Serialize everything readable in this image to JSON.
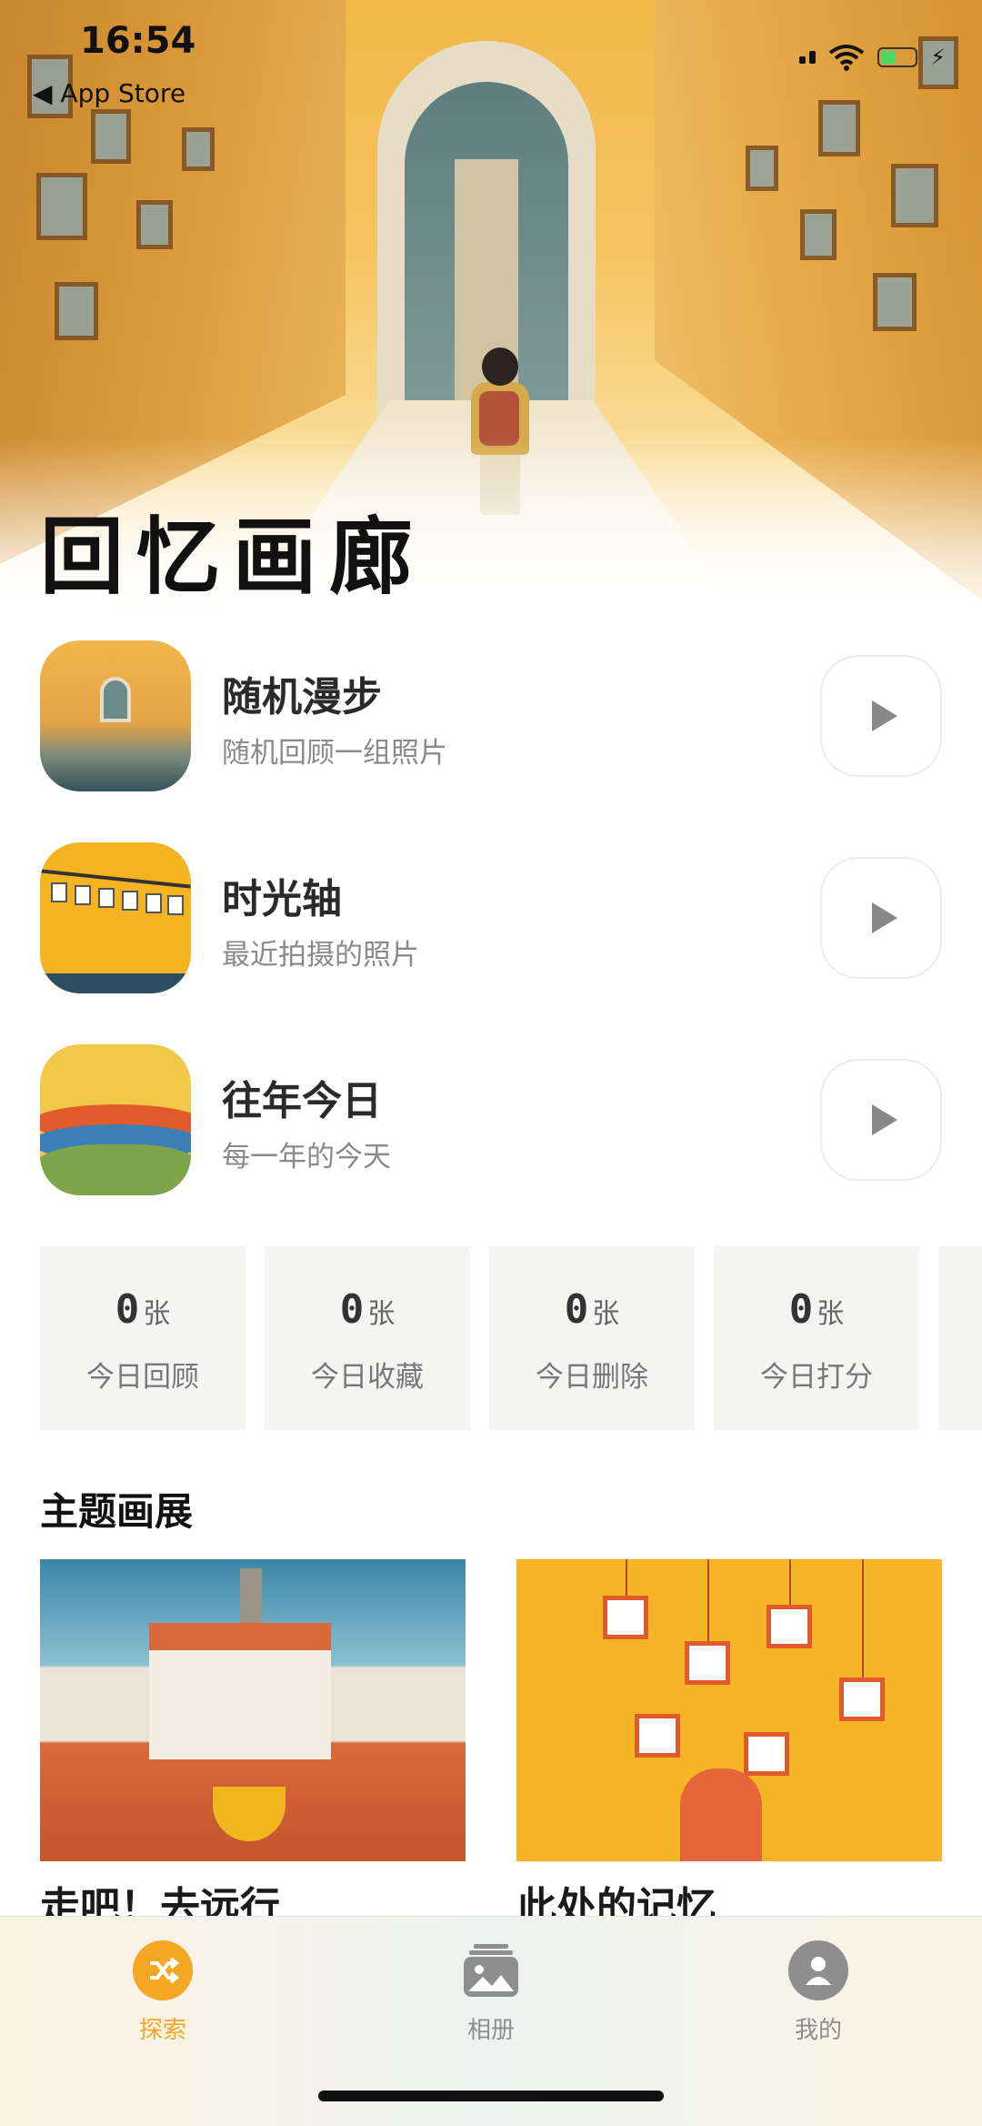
{
  "status_bar": {
    "time": "16:54",
    "back_label": "◀ App Store"
  },
  "hero": {
    "title": "回忆画廊"
  },
  "features": [
    {
      "title": "随机漫步",
      "subtitle": "随机回顾一组照片"
    },
    {
      "title": "时光轴",
      "subtitle": "最近拍摄的照片"
    },
    {
      "title": "往年今日",
      "subtitle": "每一年的今天"
    }
  ],
  "stats": [
    {
      "value": "0",
      "unit": "张",
      "label": "今日回顾"
    },
    {
      "value": "0",
      "unit": "张",
      "label": "今日收藏"
    },
    {
      "value": "0",
      "unit": "张",
      "label": "今日删除"
    },
    {
      "value": "0",
      "unit": "张",
      "label": "今日打分"
    }
  ],
  "themes": {
    "section_title": "主题画展",
    "cards": [
      {
        "title": "走吧！去远行"
      },
      {
        "title": "此处的记忆"
      }
    ]
  },
  "tabbar": {
    "tabs": [
      {
        "label": "探索",
        "icon": "shuffle-icon",
        "active": true
      },
      {
        "label": "相册",
        "icon": "photo-album-icon",
        "active": false
      },
      {
        "label": "我的",
        "icon": "person-icon",
        "active": false
      }
    ],
    "active_color": "#f5a623",
    "inactive_color": "#8e8e8e"
  }
}
